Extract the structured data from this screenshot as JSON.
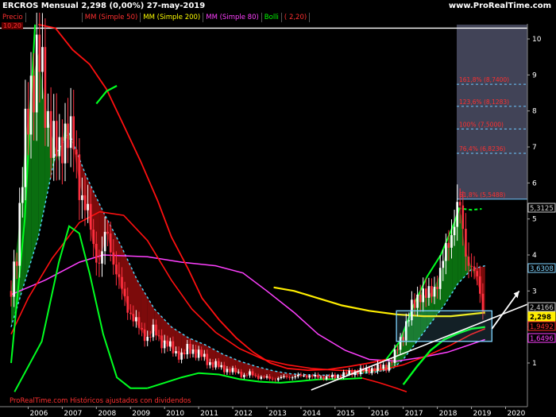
{
  "header": {
    "title": "ERCROS  Mensual   2,298 (0,00%)   27-may-2019",
    "site": "www.ProRealTime.com"
  },
  "legend": [
    {
      "label": "Precio",
      "color": "#ff3030"
    },
    {
      "label": "",
      "color": "#00b8ff"
    },
    {
      "label": "MM (Simple 50)",
      "color": "#ff3030"
    },
    {
      "label": "MM (Simple 200)",
      "color": "#ffff00"
    },
    {
      "label": "MM (Simple 80)",
      "color": "#ff40ff"
    },
    {
      "label": "Bolli",
      "color": "#00ff00"
    },
    {
      "label": "( 2,20)",
      "color": "#ff3030"
    }
  ],
  "corner_value": "10,20",
  "watermark": "ProRealTime.com  Históricos ajustados con dividendos",
  "colors": {
    "bull": "#ffffff",
    "bear": "#ff3040",
    "bg": "#000000",
    "ma50": "#ff1010",
    "ma200": "#ffee00",
    "ma80": "#ff40ff",
    "boll": "#00ff20",
    "cloud_up": "#0b7a12",
    "cloud_down": "#8a0c0c",
    "fib_zone": "#4c4f66",
    "fib_line": "#6ec8ff"
  },
  "chart_data": {
    "type": "candlestick",
    "x_ticks": [
      "2006",
      "2007",
      "2008",
      "2009",
      "2010",
      "2011",
      "2012",
      "2013",
      "2014",
      "2015",
      "2016",
      "2017",
      "2018",
      "2019",
      "2020"
    ],
    "y_ticks": [
      "1",
      "2",
      "3",
      "4",
      "5",
      "6",
      "7",
      "8",
      "9",
      "10"
    ],
    "ylim": [
      0.2,
      10.6
    ],
    "price_tags": [
      {
        "label": "5,3125",
        "value": 5.3125,
        "color": "#cfcfcf"
      },
      {
        "label": "3,6308",
        "value": 3.6308,
        "color": "#7fd4ff"
      },
      {
        "label": "2,4166",
        "value": 2.4166,
        "color": "#cfcfcf"
      },
      {
        "label": "2,298",
        "value": 2.298,
        "color": "#ffee00"
      },
      {
        "label": "1,9492",
        "value": 1.9492,
        "color": "#ff3030"
      },
      {
        "label": "1,6496",
        "value": 1.6496,
        "color": "#ff40ff"
      }
    ],
    "fib_levels": [
      {
        "label": "61,8% (5,5488)",
        "value": 5.5488
      },
      {
        "label": "76,4% (6,8236)",
        "value": 6.8236
      },
      {
        "label": "100% (7,5000)",
        "value": 7.5
      },
      {
        "label": "123,6% (8,1283)",
        "value": 8.1283
      },
      {
        "label": "161,8% (8,7400)",
        "value": 8.74
      }
    ],
    "resistance_line": 10.3
  }
}
